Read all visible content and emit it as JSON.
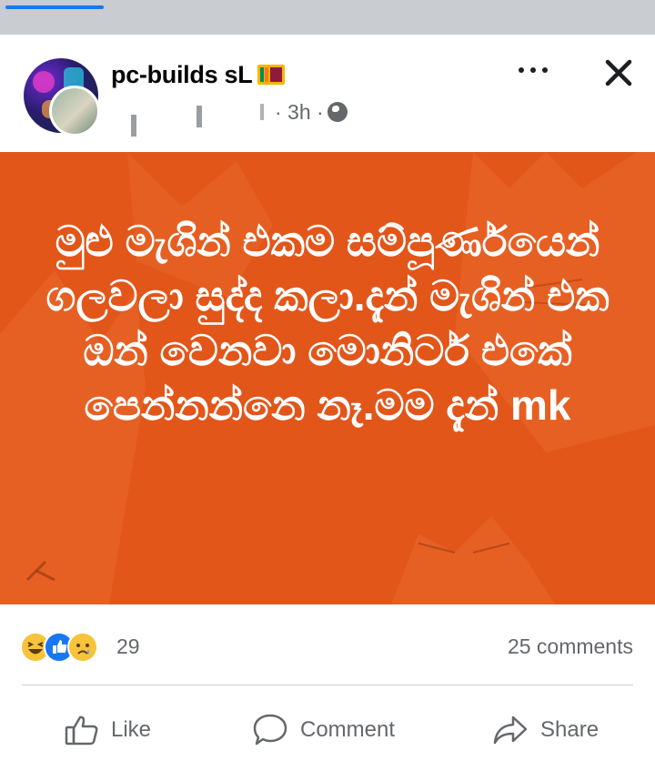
{
  "post": {
    "page_name": "pc-builds sL",
    "time": "· 3h ·",
    "text": "මුළු මැශින් එකම සම්පූර්ණයෙන් ගලවලා සුද්ද කලා.දැන් මැශින් එක ඔන් වෙනවා මොනිටර් එකේ පෙන්නන්නෙ නෑ.මම දැන් mk",
    "background_color": "#e2561a"
  },
  "reactions": {
    "icons": [
      "haha-icon",
      "like-icon",
      "sad-icon"
    ],
    "count": "29"
  },
  "comments": {
    "count_label": "25 comments"
  },
  "actions": {
    "like": "Like",
    "comment": "Comment",
    "share": "Share"
  },
  "colors": {
    "accent": "#1877f2",
    "secondary_text": "#65676b",
    "top_bar": "#c9ccd1"
  }
}
